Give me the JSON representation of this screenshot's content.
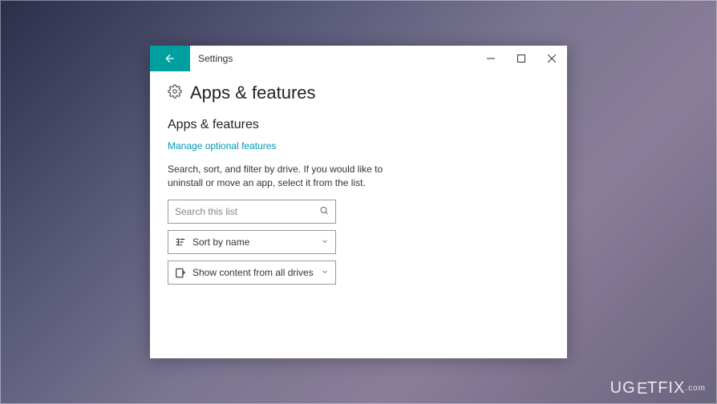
{
  "window": {
    "title": "Settings"
  },
  "page": {
    "header": "Apps & features",
    "section_title": "Apps & features",
    "link": "Manage optional features",
    "description": "Search, sort, and filter by drive. If you would like to uninstall or move an app, select it from the list."
  },
  "controls": {
    "search_placeholder": "Search this list",
    "sort_label": "Sort by name",
    "filter_label": "Show content from all drives"
  },
  "watermark": "UG∃TFIX"
}
